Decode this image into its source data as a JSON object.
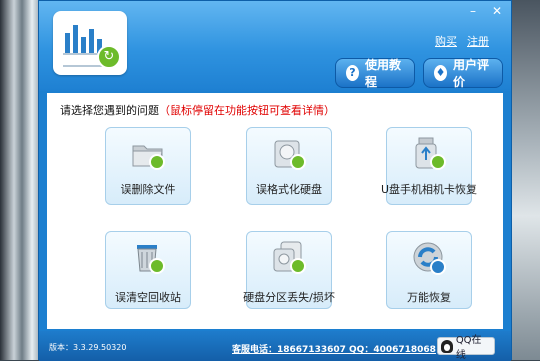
{
  "window": {
    "close_glyph": "✕",
    "minimize_glyph": "–"
  },
  "header": {
    "links": {
      "buy": "购买",
      "register": "注册"
    },
    "tutorial_label": "使用教程",
    "review_label": "用户评价"
  },
  "content": {
    "prompt": "请选择您遇到的问题",
    "hint": "（鼠标停留在功能按钮可查看详情）",
    "tiles": [
      {
        "label": "误删除文件",
        "icon": "folder-recover-icon"
      },
      {
        "label": "误格式化硬盘",
        "icon": "harddisk-recover-icon"
      },
      {
        "label": "U盘手机相机卡恢复",
        "icon": "usb-drive-recover-icon"
      },
      {
        "label": "误清空回收站",
        "icon": "recycle-bin-recover-icon"
      },
      {
        "label": "硬盘分区丢失/损坏",
        "icon": "partition-recover-icon"
      },
      {
        "label": "万能恢复",
        "icon": "universal-recover-icon"
      }
    ]
  },
  "status": {
    "version": "版本：3.3.29.50320",
    "contact": "客服电话：18667133607 QQ：4006718068",
    "qq_label": "QQ在线"
  },
  "colors": {
    "accent": "#1c7fd0",
    "hint": "#e00000",
    "recover_badge": "#6dbb2a"
  }
}
